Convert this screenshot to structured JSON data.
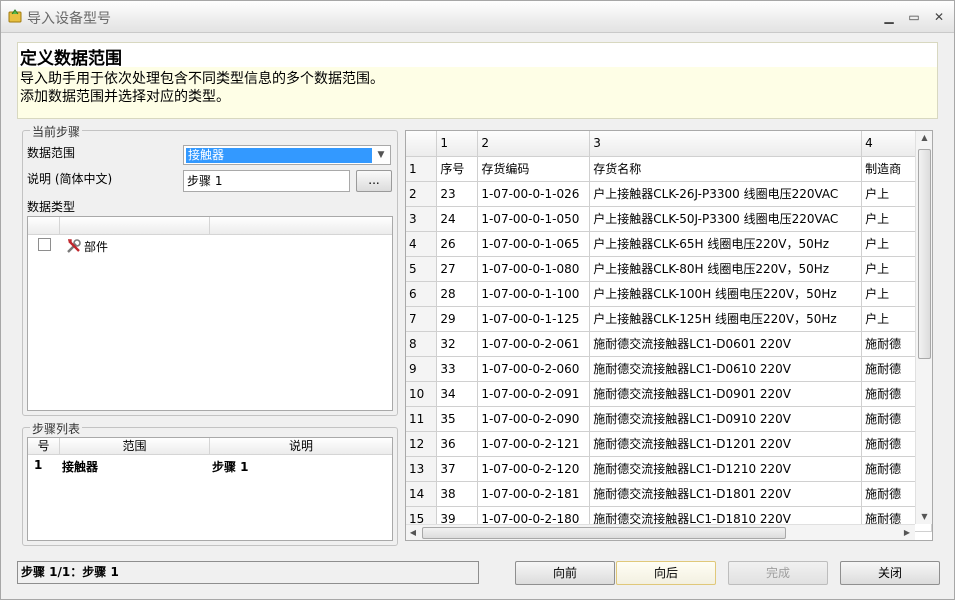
{
  "window": {
    "title": "导入设备型号",
    "minimize": "▁",
    "maximize": "▭",
    "close": "✕"
  },
  "header": {
    "title": "定义数据范围",
    "line1": "导入助手用于依次处理包含不同类型信息的多个数据范围。",
    "line2": "添加数据范围并选择对应的类型。"
  },
  "current_step": {
    "legend": "当前步骤",
    "range_label": "数据范围",
    "range_value": "接触器",
    "desc_label": "说明 (简体中文)",
    "desc_value": "步骤 1",
    "browse_label": "...",
    "type_label": "数据类型",
    "types": [
      {
        "label": "部件",
        "checked": false
      }
    ]
  },
  "step_list": {
    "legend": "步骤列表",
    "columns": [
      "号",
      "范围",
      "说明"
    ],
    "rows": [
      [
        "1",
        "接触器",
        "步骤 1"
      ]
    ]
  },
  "grid": {
    "col_headers": [
      "",
      "1",
      "2",
      "3",
      "4"
    ],
    "rows": [
      [
        "1",
        "序号",
        "存货编码",
        "存货名称",
        "制造商"
      ],
      [
        "2",
        "23",
        "1-07-00-0-1-026",
        "户上接触器CLK-26J-P3300  线圈电压220VAC",
        "户上"
      ],
      [
        "3",
        "24",
        "1-07-00-0-1-050",
        "户上接触器CLK-50J-P3300  线圈电压220VAC",
        "户上"
      ],
      [
        "4",
        "26",
        "1-07-00-0-1-065",
        "户上接触器CLK-65H     线圈电压220V，50Hz",
        "户上"
      ],
      [
        "5",
        "27",
        "1-07-00-0-1-080",
        "户上接触器CLK-80H     线圈电压220V，50Hz",
        "户上"
      ],
      [
        "6",
        "28",
        "1-07-00-0-1-100",
        "户上接触器CLK-100H    线圈电压220V，50Hz",
        "户上"
      ],
      [
        "7",
        "29",
        "1-07-00-0-1-125",
        "户上接触器CLK-125H    线圈电压220V，50Hz",
        "户上"
      ],
      [
        "8",
        "32",
        "1-07-00-0-2-061",
        "施耐德交流接触器LC1-D0601 220V",
        "施耐德"
      ],
      [
        "9",
        "33",
        "1-07-00-0-2-060",
        "施耐德交流接触器LC1-D0610 220V",
        "施耐德"
      ],
      [
        "10",
        "34",
        "1-07-00-0-2-091",
        "施耐德交流接触器LC1-D0901 220V",
        "施耐德"
      ],
      [
        "11",
        "35",
        "1-07-00-0-2-090",
        "施耐德交流接触器LC1-D0910 220V",
        "施耐德"
      ],
      [
        "12",
        "36",
        "1-07-00-0-2-121",
        "施耐德交流接触器LC1-D1201 220V",
        "施耐德"
      ],
      [
        "13",
        "37",
        "1-07-00-0-2-120",
        "施耐德交流接触器LC1-D1210 220V",
        "施耐德"
      ],
      [
        "14",
        "38",
        "1-07-00-0-2-181",
        "施耐德交流接触器LC1-D1801 220V",
        "施耐德"
      ],
      [
        "15",
        "39",
        "1-07-00-0-2-180",
        "施耐德交流接触器LC1-D1810 220V",
        "施耐德"
      ]
    ]
  },
  "status": "步骤 1/1：步骤 1",
  "buttons": {
    "back": "向前",
    "next": "向后",
    "finish": "完成",
    "close": "关闭"
  }
}
